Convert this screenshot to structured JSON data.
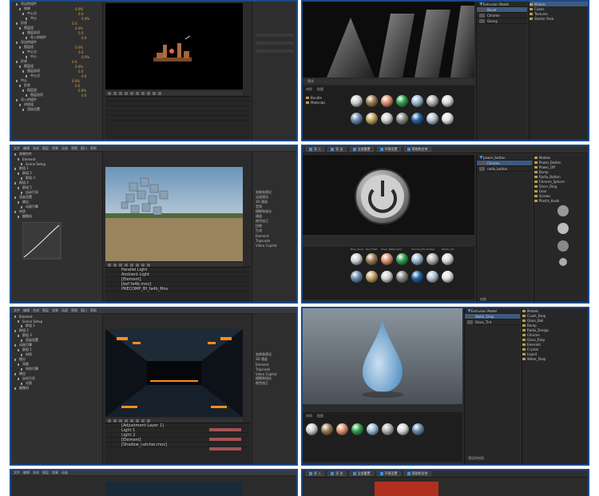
{
  "panel_1": {
    "tree": [
      {
        "label": "导出的组件",
        "value": ""
      },
      {
        "label": "效果",
        "value": "0.0%"
      },
      {
        "label": "中心点",
        "value": "0.0"
      },
      {
        "label": "中心",
        "value": "0.0%"
      },
      {
        "label": "形状",
        "value": "0.0"
      },
      {
        "label": "图层组",
        "value": "0.0%"
      },
      {
        "label": "图层选项",
        "value": "0.0"
      },
      {
        "label": "导入的组件",
        "value": "0.0"
      },
      {
        "label": "导出的组件",
        "value": ""
      },
      {
        "label": "图层组",
        "value": "0.0%"
      },
      {
        "label": "中心点",
        "value": "0.0"
      },
      {
        "label": "中心",
        "value": "0.0%"
      },
      {
        "label": "形状",
        "value": "0.0"
      },
      {
        "label": "图层组",
        "value": "0.0%"
      },
      {
        "label": "图层选项",
        "value": "0.0"
      },
      {
        "label": "中心点",
        "value": "0.0"
      },
      {
        "label": "中心",
        "value": "0.0%"
      },
      {
        "label": "形状",
        "value": "0.0"
      },
      {
        "label": "图层组",
        "value": "0.0%"
      },
      {
        "label": "图层选项",
        "value": "0.0"
      },
      {
        "label": "导入的组件",
        "value": ""
      },
      {
        "label": "材质组",
        "value": ""
      },
      {
        "label": "渲染设置",
        "value": ""
      }
    ]
  },
  "panel_2": {
    "toolbar": [
      "导 入",
      "导 出",
      "环境设置",
      "帮助和支持"
    ],
    "scene_title": "Extrusion Model",
    "scene_items": [
      "Bevel",
      "Chrome",
      "Glossy"
    ],
    "preview_label": "预览",
    "material_tabs": [
      "材质",
      "贴图"
    ],
    "folders": [
      "Bundle",
      "Materials"
    ],
    "side_list": [
      "Models",
      "Cubes",
      "Textures",
      "Starter Pack"
    ]
  },
  "panel_3": {
    "menu": [
      "文件",
      "编辑",
      "合成",
      "图层",
      "效果",
      "动画",
      "视图",
      "窗口",
      "帮助"
    ],
    "tree": [
      "效果控件",
      "Element",
      "Scene Setup",
      "群组 1",
      "群组 2",
      "群组 3",
      "群组 4",
      "群组 5",
      "自动引导",
      "渲染设置",
      "输出",
      "动画引擎",
      "材质",
      "摄像机"
    ],
    "layers": [
      "Parallel Light",
      "Ambient Light",
      "[Element]",
      "[bef fa4b.mov]",
      "PRECOMP_Bf_fa4b_Mov"
    ],
    "right_items": [
      "效果和预设",
      "动画预设",
      "3D 通道",
      "音频",
      "模糊和锐化",
      "通道",
      "颜色校正",
      "扭曲",
      "生成",
      "Element",
      "Trapcode",
      "Video Copilot"
    ]
  },
  "panel_4": {
    "toolbar": [
      "导 入",
      "导 出",
      "全部重置",
      "环境设置",
      "帮助和支持"
    ],
    "scene_items": [
      "power_button",
      "Chrome",
      "radio_button"
    ],
    "tree": [
      "Models",
      "Power_Button",
      "Power_Off",
      "Bump",
      "Radio_Button",
      "Chrome_Sphere",
      "Silver_Ring",
      "Gear",
      "Screws",
      "Plastic_Knob"
    ],
    "material_labels": [
      "Blue_Gloss",
      "Red_Plast",
      "Silver_Metal",
      "Gold",
      "Chrome_Pro",
      "Rubber",
      "Plastic_Alu"
    ],
    "bottom": "材质"
  },
  "panel_5": {
    "menu": [
      "文件",
      "编辑",
      "合成",
      "图层",
      "效果",
      "动画",
      "视图",
      "窗口",
      "帮助"
    ],
    "tree": [
      "Element",
      "Scene Setup",
      "群组 1",
      "群组 2",
      "群组 3",
      "渲染设置",
      "动画引擎",
      "群组 1",
      "材质",
      "细分",
      "深度",
      "材质引擎",
      "输出",
      "自动引导",
      "光照",
      "摄像机"
    ],
    "layers": [
      "[Adjustment Layer 1]",
      "Light 1",
      "Light 2",
      "[Element]",
      "[Shadow_catcher.mov]"
    ],
    "right_items": [
      "效果和预设",
      "3D 通道",
      "Element",
      "Trapcode",
      "Video Copilot",
      "模糊和锐化",
      "颜色校正"
    ]
  },
  "panel_6": {
    "toolbar": [
      "导 入",
      "导 出",
      "全部重置",
      "环境设置",
      "帮助和支持"
    ],
    "scene_title": "Extrusion Model",
    "scene_items": [
      "Water_Drop",
      "Glass_Tint"
    ],
    "tree": [
      "Models",
      "Crush_Drop",
      "Glass_Ball",
      "Bump",
      "Radio_Design",
      "Chrome",
      "Glass_Ring",
      "Emerald",
      "Crystal",
      "Liquid",
      "Water_Drop"
    ],
    "material_tabs": [
      "材质",
      "贴图"
    ],
    "bottom": "预设的材质"
  },
  "panel_7": {
    "menu": [
      "文件",
      "编辑",
      "合成",
      "图层",
      "效果",
      "动画"
    ]
  },
  "panel_8": {
    "toolbar": [
      "导 入",
      "导 出",
      "全部重置",
      "环境设置",
      "帮助和支持"
    ]
  },
  "colors": {
    "frame": "#1a4a8a",
    "panel": "#2b2b2b",
    "accent_blue": "#3d8fe0",
    "orange": "#e0a34a"
  }
}
